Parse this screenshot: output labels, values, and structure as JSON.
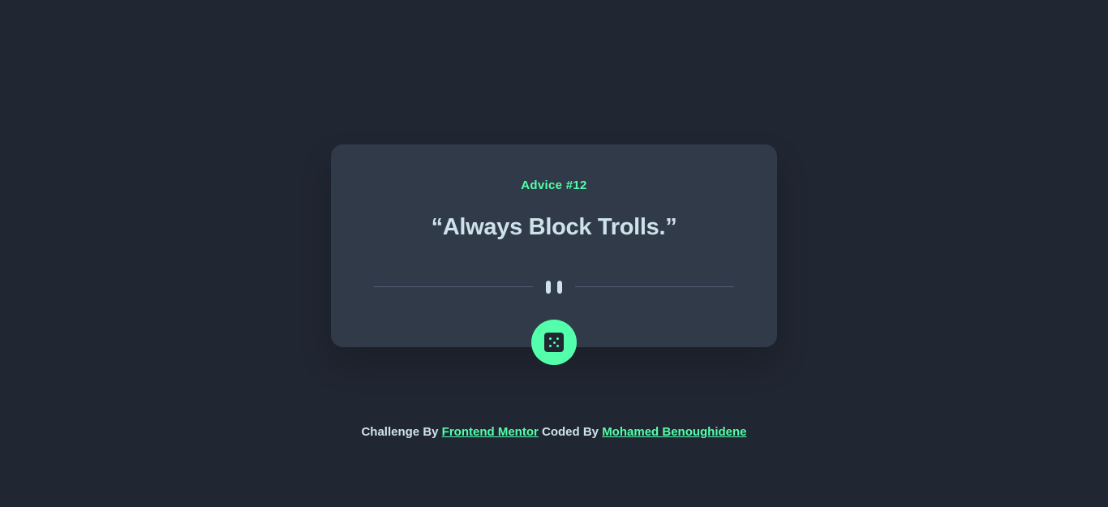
{
  "card": {
    "advice_label": "Advice #12",
    "advice_text": "“Always Block Trolls.”"
  },
  "footer": {
    "challenge_prefix": "Challenge By",
    "challenge_link": "Frontend Mentor",
    "coded_prefix": "Coded By",
    "coded_link": "Mohamed Benoughidene"
  },
  "icons": {
    "divider_icon": "pause-icon",
    "button_icon": "dice-icon"
  },
  "colors": {
    "background": "#202632",
    "card": "#313a49",
    "accent": "#53ffab",
    "text": "#cee3e9",
    "divider": "#4f5d74"
  }
}
